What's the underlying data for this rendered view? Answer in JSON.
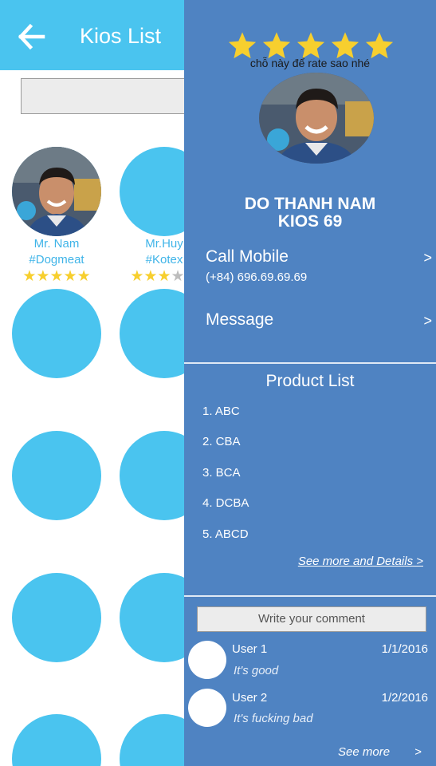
{
  "header": {
    "title": "Kios List",
    "back_icon": "arrow-left-icon"
  },
  "search": {
    "value": "",
    "placeholder": ""
  },
  "kios_list": [
    {
      "name": "Mr. Nam",
      "tag": "#Dogmeat",
      "rating": 5,
      "has_photo": true
    },
    {
      "name": "Mr.Huy",
      "tag": "#Kotex",
      "rating": 3,
      "has_photo": false
    },
    {
      "name": "",
      "tag": "",
      "rating": null,
      "has_photo": false
    },
    {
      "name": "",
      "tag": "",
      "rating": null,
      "has_photo": false
    },
    {
      "name": "",
      "tag": "",
      "rating": null,
      "has_photo": false
    },
    {
      "name": "",
      "tag": "",
      "rating": null,
      "has_photo": false
    },
    {
      "name": "",
      "tag": "",
      "rating": null,
      "has_photo": false
    },
    {
      "name": "",
      "tag": "",
      "rating": null,
      "has_photo": false
    },
    {
      "name": "",
      "tag": "",
      "rating": null,
      "has_photo": false
    },
    {
      "name": "",
      "tag": "",
      "rating": null,
      "has_photo": false
    }
  ],
  "panel": {
    "rating": 5,
    "rating_note": "chỗ này để rate sao nhé",
    "owner_name": "DO THANH NAM",
    "kios_code": "KIOS 69",
    "call": {
      "label": "Call Mobile",
      "number": "(+84) 696.69.69.69",
      "chevron": ">"
    },
    "message": {
      "label": "Message",
      "chevron": ">"
    },
    "products": {
      "title": "Product List",
      "items": [
        "1. ABC",
        "2. CBA",
        "3. BCA",
        "4. DCBA",
        "5. ABCD"
      ],
      "details_link": "See more and Details >"
    },
    "comments": {
      "input_placeholder": "Write your comment",
      "items": [
        {
          "user": "User 1",
          "date": "1/1/2016",
          "text": "It's good"
        },
        {
          "user": "User 2",
          "date": "1/2/2016",
          "text": "It's fucking bad"
        }
      ],
      "see_more": "See more",
      "see_more_chevron": ">"
    }
  },
  "colors": {
    "topbar": "#4ac4ef",
    "panel": "#4f83c2",
    "star": "#f7cf2e",
    "star_empty": "#bdbdbd",
    "kios_link_text": "#3fb4e8"
  }
}
